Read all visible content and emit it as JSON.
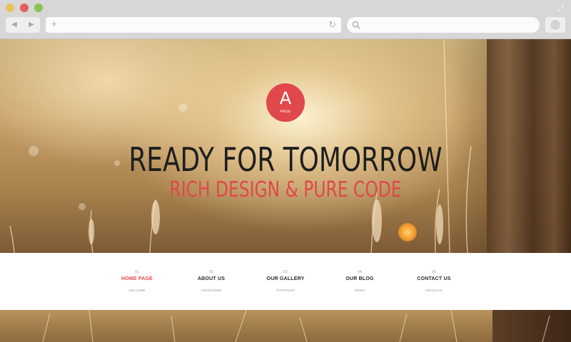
{
  "browser": {
    "back_icon": "◀",
    "forward_icon": "▶",
    "new_tab_icon": "+",
    "reload_icon": "↻",
    "resize_icon": "⤢",
    "url_value": "",
    "search_value": ""
  },
  "hero": {
    "logo_letter": "A",
    "logo_sub": "PAGE",
    "headline": "READY FOR TOMORROW",
    "subheadline": "RICH DESIGN & PURE CODE",
    "accent_color": "#e0484b"
  },
  "nav": {
    "items": [
      {
        "num": "01",
        "label": "HOME PAGE",
        "sub": "WELCOME",
        "active": true
      },
      {
        "num": "02",
        "label": "ABOUT US",
        "sub": "KNOW MORE",
        "active": false
      },
      {
        "num": "03",
        "label": "OUR GALLERY",
        "sub": "PORTFOLIO",
        "active": false
      },
      {
        "num": "04",
        "label": "OUR BLOG",
        "sub": "NEWS",
        "active": false
      },
      {
        "num": "05",
        "label": "CONTACT US",
        "sub": "REACH US",
        "active": false
      }
    ]
  }
}
